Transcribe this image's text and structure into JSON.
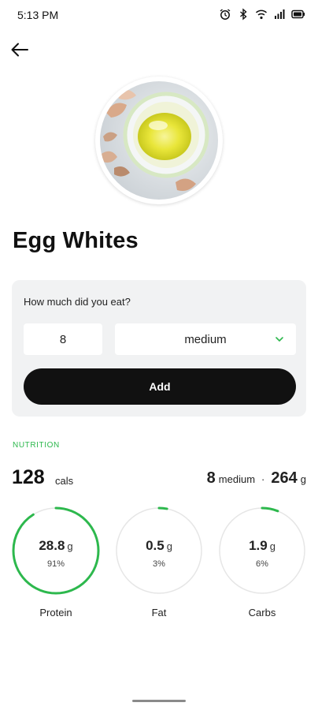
{
  "status_bar": {
    "time": "5:13 PM",
    "icons": [
      "alarm-icon",
      "bluetooth-icon",
      "wifi-icon",
      "signal-icon",
      "battery-icon"
    ]
  },
  "header": {
    "back_icon": "arrow-left-icon"
  },
  "food": {
    "title": "Egg Whites"
  },
  "portion": {
    "question": "How much did you eat?",
    "quantity": "8",
    "unit": "medium",
    "add_label": "Add"
  },
  "nutrition": {
    "label": "NUTRITION",
    "calories": "128",
    "calories_unit": "cals",
    "serving_quantity": "8",
    "serving_unit": "medium",
    "separator": "·",
    "serving_weight": "264",
    "serving_weight_unit": "g",
    "macros": [
      {
        "name": "Protein",
        "amount": "28.8",
        "unit": "g",
        "percent": "91%",
        "fraction": 0.91
      },
      {
        "name": "Fat",
        "amount": "0.5",
        "unit": "g",
        "percent": "3%",
        "fraction": 0.03
      },
      {
        "name": "Carbs",
        "amount": "1.9",
        "unit": "g",
        "percent": "6%",
        "fraction": 0.06
      }
    ]
  },
  "colors": {
    "accent": "#2db84d",
    "ring_track": "#e6e6e6",
    "button": "#111111",
    "card": "#f1f2f3"
  }
}
